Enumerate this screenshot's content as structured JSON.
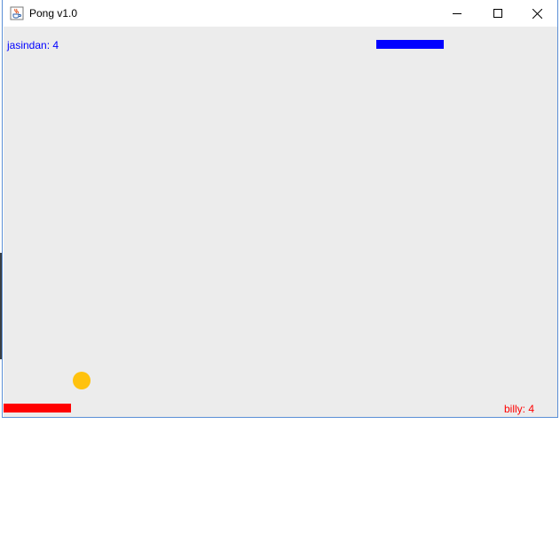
{
  "window": {
    "title": "Pong v1.0",
    "icon": "java-cup-icon",
    "controls": {
      "minimize_icon": "minimize-icon",
      "maximize_icon": "maximize-icon",
      "close_icon": "close-icon"
    }
  },
  "game": {
    "background": "#ececec",
    "top_player": {
      "score_text": "jasindan: 4",
      "color": "#0000ff"
    },
    "bottom_player": {
      "score_text": "billy: 4",
      "color": "#ff0000"
    },
    "ball": {
      "color": "#ffc20e"
    }
  }
}
